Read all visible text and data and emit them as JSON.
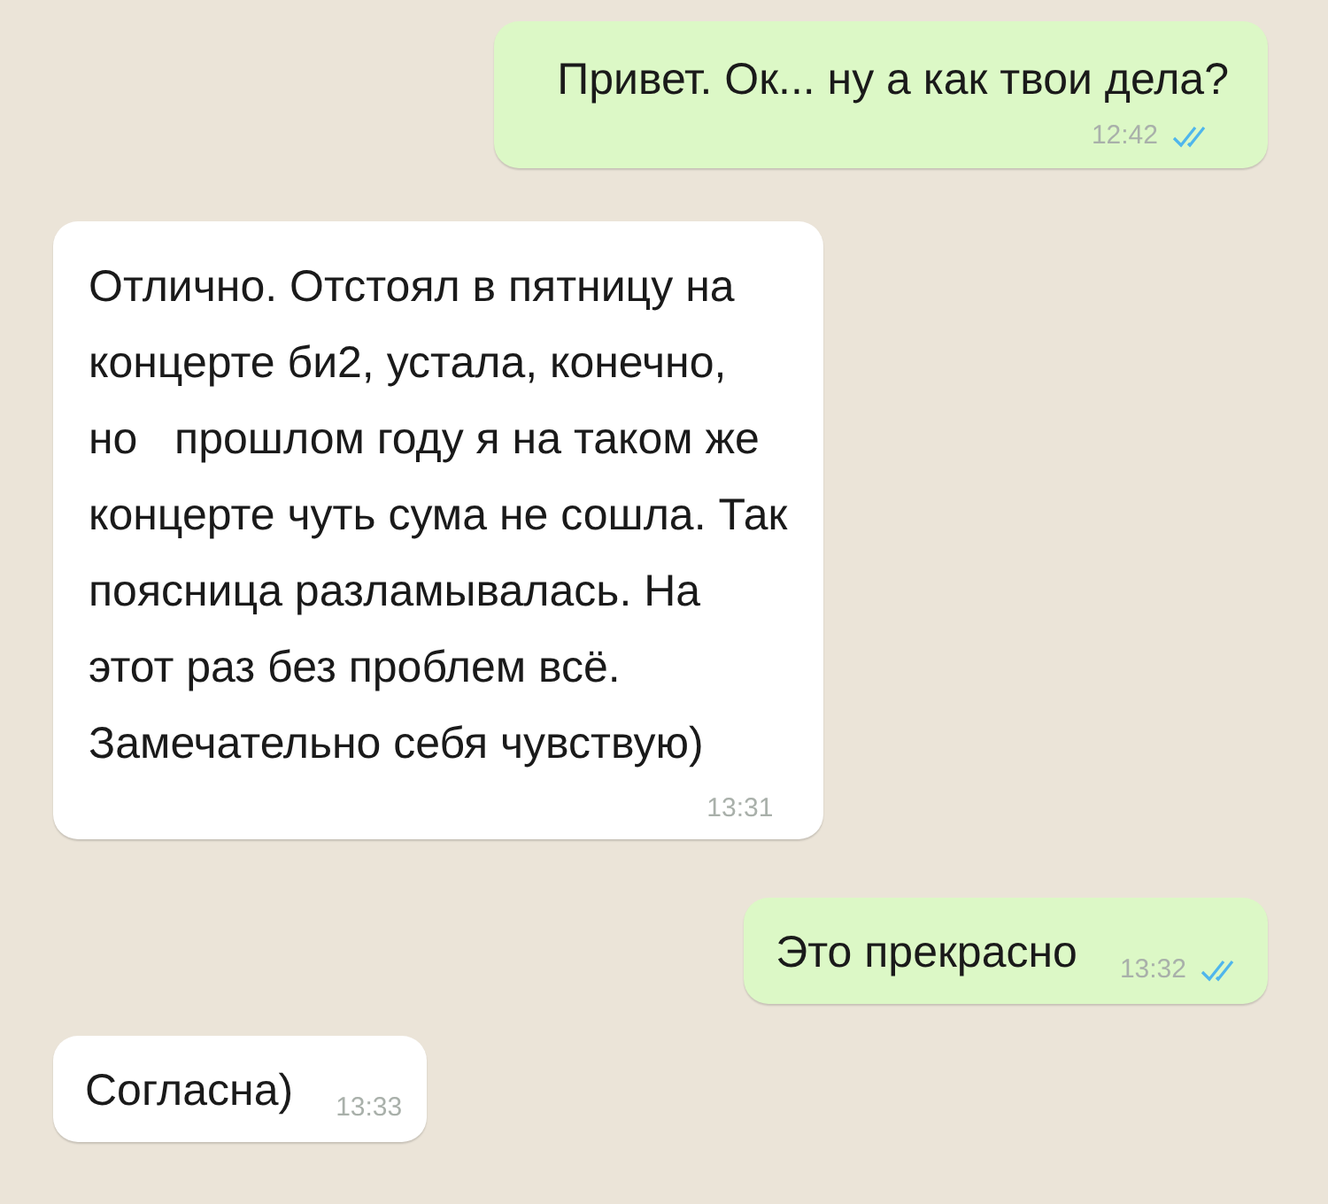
{
  "messages": [
    {
      "outgoing": true,
      "text": "Привет. Ок... ну а как твои дела?",
      "time": "12:42",
      "read": true
    },
    {
      "outgoing": false,
      "text": "Отлично. Отстоял в пятницу на\nконцерте би2, устала, конечно,\nно   прошлом году я на таком же\nконцерте чуть сума не сошла. Так\nпоясница разламывалась. На\nэтот раз без проблем всё.\nЗамечательно себя чувствую)",
      "time": "13:31"
    },
    {
      "outgoing": true,
      "text": "Это прекрасно",
      "time": "13:32",
      "read": true
    },
    {
      "outgoing": false,
      "text": "Согласна)",
      "time": "13:33"
    }
  ]
}
